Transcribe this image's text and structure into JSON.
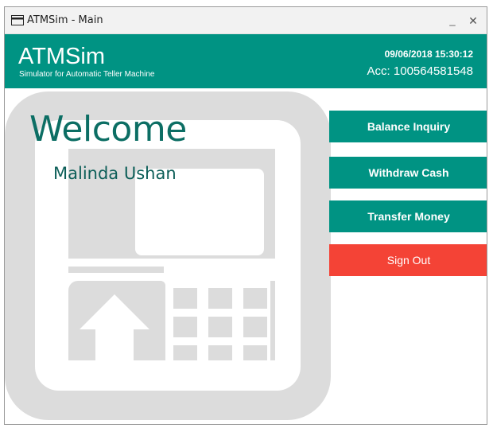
{
  "window": {
    "title": "ATMSim - Main",
    "minimize_label": "_",
    "close_label": "✕"
  },
  "header": {
    "app_name": "ATMSim",
    "subtitle": "Simulator for Automatic Teller Machine",
    "datetime": "09/06/2018 15:30:12",
    "account": "Acc: 100564581548"
  },
  "main": {
    "welcome": "Welcome",
    "user_name": "Malinda Ushan"
  },
  "menu": {
    "balance_inquiry": "Balance Inquiry",
    "withdraw_cash": "Withdraw Cash",
    "transfer_money": "Transfer Money",
    "sign_out": "Sign Out"
  },
  "colors": {
    "primary": "#009383",
    "danger": "#f44336",
    "welcome_text": "#0c6e64",
    "background_art": "#dcdcdc"
  },
  "icons": {
    "app": "card-window-icon",
    "background": "atm-machine-icon"
  }
}
